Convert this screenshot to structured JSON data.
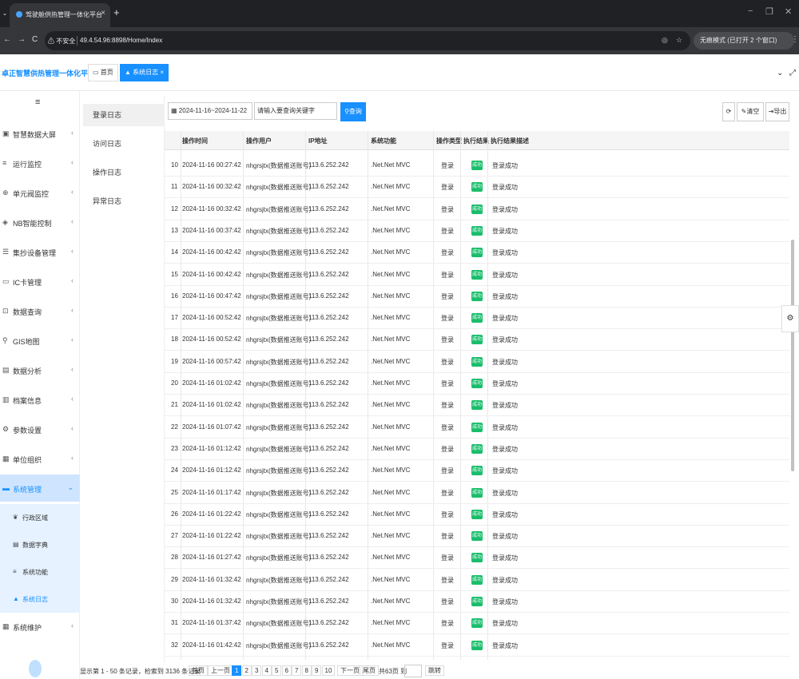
{
  "browser": {
    "tab_title": "驾驶舱供热管理一体化平台",
    "tab_close": "×",
    "new_tab": "+",
    "menu_caret": "⌄",
    "win_min": "−",
    "win_restore": "❐",
    "win_close": "✕",
    "url_warning": "⚠ 不安全",
    "url": "49.4.54.96:8898/Home/Index",
    "incognito": "无痕模式 (已打开 2 个窗口)",
    "more": "⋮"
  },
  "header": {
    "brand": "卓正智慧供热管理一体化平台",
    "tabs": [
      {
        "label": "首页",
        "icon": "monitor-icon"
      },
      {
        "label": "系统日志 ×",
        "icon": "warning-icon"
      }
    ],
    "right_caret": "⌄",
    "right_expand": "⤢"
  },
  "sidebar": {
    "hamburger": "≡",
    "items": [
      {
        "label": "智慧数据大屏",
        "icon": "screen-icon"
      },
      {
        "label": "运行监控",
        "icon": "list-icon"
      },
      {
        "label": "单元阀监控",
        "icon": "valve-icon"
      },
      {
        "label": "NB智能控制",
        "icon": "nb-icon"
      },
      {
        "label": "集抄设备管理",
        "icon": "device-icon"
      },
      {
        "label": "IC卡管理",
        "icon": "card-icon"
      },
      {
        "label": "数据查询",
        "icon": "search-icon"
      },
      {
        "label": "GIS地图",
        "icon": "map-pin-icon"
      },
      {
        "label": "数据分析",
        "icon": "chart-icon"
      },
      {
        "label": "档案信息",
        "icon": "archive-icon"
      },
      {
        "label": "参数设置",
        "icon": "gear-icon"
      },
      {
        "label": "单位组织",
        "icon": "org-icon"
      },
      {
        "label": "系统管理",
        "icon": "monitor-icon"
      }
    ],
    "arrow": "‹",
    "arrow_open": "⌄",
    "sub_items": [
      {
        "label": "行政区域",
        "icon": "leaf-icon"
      },
      {
        "label": "数据字典",
        "icon": "book-icon"
      },
      {
        "label": "系统功能",
        "icon": "list-icon"
      },
      {
        "label": "系统日志",
        "icon": "warning-icon"
      }
    ],
    "bottom_item": {
      "label": "系统维护",
      "icon": "windows-icon"
    }
  },
  "log_types": [
    "登录日志",
    "访问日志",
    "操作日志",
    "异常日志"
  ],
  "filters": {
    "date_range": "2024-11-16~2024-11-22",
    "keyword_placeholder": "请输入要查询关键字",
    "query_label": "查询",
    "refresh_label": "⟳",
    "clear_label": "清空",
    "export_label": "导出"
  },
  "table": {
    "headers": [
      "操作时间",
      "操作用户",
      "IP地址",
      "系统功能",
      "操作类型",
      "执行结果",
      "执行结果描述"
    ],
    "badge_text": "成功",
    "rows": [
      {
        "no": "10",
        "time": "2024-11-16 00:27:42",
        "user": "nhgrsjtx(数据推送账号)",
        "ip": "113.6.252.242",
        "func": ".Net.Net MVC",
        "type": "登录",
        "desc": "登录成功"
      },
      {
        "no": "11",
        "time": "2024-11-16 00:32:42",
        "user": "nhgrsjtx(数据推送账号)",
        "ip": "113.6.252.242",
        "func": ".Net.Net MVC",
        "type": "登录",
        "desc": "登录成功"
      },
      {
        "no": "12",
        "time": "2024-11-16 00:32:42",
        "user": "nhgrsjtx(数据推送账号)",
        "ip": "113.6.252.242",
        "func": ".Net.Net MVC",
        "type": "登录",
        "desc": "登录成功"
      },
      {
        "no": "13",
        "time": "2024-11-16 00:37:42",
        "user": "nhgrsjtx(数据推送账号)",
        "ip": "113.6.252.242",
        "func": ".Net.Net MVC",
        "type": "登录",
        "desc": "登录成功"
      },
      {
        "no": "14",
        "time": "2024-11-16 00:42:42",
        "user": "nhgrsjtx(数据推送账号)",
        "ip": "113.6.252.242",
        "func": ".Net.Net MVC",
        "type": "登录",
        "desc": "登录成功"
      },
      {
        "no": "15",
        "time": "2024-11-16 00:42:42",
        "user": "nhgrsjtx(数据推送账号)",
        "ip": "113.6.252.242",
        "func": ".Net.Net MVC",
        "type": "登录",
        "desc": "登录成功"
      },
      {
        "no": "16",
        "time": "2024-11-16 00:47:42",
        "user": "nhgrsjtx(数据推送账号)",
        "ip": "113.6.252.242",
        "func": ".Net.Net MVC",
        "type": "登录",
        "desc": "登录成功"
      },
      {
        "no": "17",
        "time": "2024-11-16 00:52:42",
        "user": "nhgrsjtx(数据推送账号)",
        "ip": "113.6.252.242",
        "func": ".Net.Net MVC",
        "type": "登录",
        "desc": "登录成功"
      },
      {
        "no": "18",
        "time": "2024-11-16 00:52:42",
        "user": "nhgrsjtx(数据推送账号)",
        "ip": "113.6.252.242",
        "func": ".Net.Net MVC",
        "type": "登录",
        "desc": "登录成功"
      },
      {
        "no": "19",
        "time": "2024-11-16 00:57:42",
        "user": "nhgrsjtx(数据推送账号)",
        "ip": "113.6.252.242",
        "func": ".Net.Net MVC",
        "type": "登录",
        "desc": "登录成功"
      },
      {
        "no": "20",
        "time": "2024-11-16 01:02:42",
        "user": "nhgrsjtx(数据推送账号)",
        "ip": "113.6.252.242",
        "func": ".Net.Net MVC",
        "type": "登录",
        "desc": "登录成功"
      },
      {
        "no": "21",
        "time": "2024-11-16 01:02:42",
        "user": "nhgrsjtx(数据推送账号)",
        "ip": "113.6.252.242",
        "func": ".Net.Net MVC",
        "type": "登录",
        "desc": "登录成功"
      },
      {
        "no": "22",
        "time": "2024-11-16 01:07:42",
        "user": "nhgrsjtx(数据推送账号)",
        "ip": "113.6.252.242",
        "func": ".Net.Net MVC",
        "type": "登录",
        "desc": "登录成功"
      },
      {
        "no": "23",
        "time": "2024-11-16 01:12:42",
        "user": "nhgrsjtx(数据推送账号)",
        "ip": "113.6.252.242",
        "func": ".Net.Net MVC",
        "type": "登录",
        "desc": "登录成功"
      },
      {
        "no": "24",
        "time": "2024-11-16 01:12:42",
        "user": "nhgrsjtx(数据推送账号)",
        "ip": "113.6.252.242",
        "func": ".Net.Net MVC",
        "type": "登录",
        "desc": "登录成功"
      },
      {
        "no": "25",
        "time": "2024-11-16 01:17:42",
        "user": "nhgrsjtx(数据推送账号)",
        "ip": "113.6.252.242",
        "func": ".Net.Net MVC",
        "type": "登录",
        "desc": "登录成功"
      },
      {
        "no": "26",
        "time": "2024-11-16 01:22:42",
        "user": "nhgrsjtx(数据推送账号)",
        "ip": "113.6.252.242",
        "func": ".Net.Net MVC",
        "type": "登录",
        "desc": "登录成功"
      },
      {
        "no": "27",
        "time": "2024-11-16 01:22:42",
        "user": "nhgrsjtx(数据推送账号)",
        "ip": "113.6.252.242",
        "func": ".Net.Net MVC",
        "type": "登录",
        "desc": "登录成功"
      },
      {
        "no": "28",
        "time": "2024-11-16 01:27:42",
        "user": "nhgrsjtx(数据推送账号)",
        "ip": "113.6.252.242",
        "func": ".Net.Net MVC",
        "type": "登录",
        "desc": "登录成功"
      },
      {
        "no": "29",
        "time": "2024-11-16 01:32:42",
        "user": "nhgrsjtx(数据推送账号)",
        "ip": "113.6.252.242",
        "func": ".Net.Net MVC",
        "type": "登录",
        "desc": "登录成功"
      },
      {
        "no": "30",
        "time": "2024-11-16 01:32:42",
        "user": "nhgrsjtx(数据推送账号)",
        "ip": "113.6.252.242",
        "func": ".Net.Net MVC",
        "type": "登录",
        "desc": "登录成功"
      },
      {
        "no": "31",
        "time": "2024-11-16 01:37:42",
        "user": "nhgrsjtx(数据推送账号)",
        "ip": "113.6.252.242",
        "func": ".Net.Net MVC",
        "type": "登录",
        "desc": "登录成功"
      },
      {
        "no": "32",
        "time": "2024-11-16 01:42:42",
        "user": "nhgrsjtx(数据推送账号)",
        "ip": "113.6.252.242",
        "func": ".Net.Net MVC",
        "type": "登录",
        "desc": "登录成功"
      }
    ]
  },
  "pager": {
    "summary": "显示第 1 - 50 条记录，检索到 3136 条记录",
    "first": "首页",
    "prev": "上一页",
    "pages": [
      "1",
      "2",
      "3",
      "4",
      "5",
      "6",
      "7",
      "8",
      "9",
      "10"
    ],
    "current": "1",
    "next": "下一页",
    "last": "尾页",
    "total": "共63页 到",
    "jump": "跳转"
  },
  "float_gear": "⚙"
}
